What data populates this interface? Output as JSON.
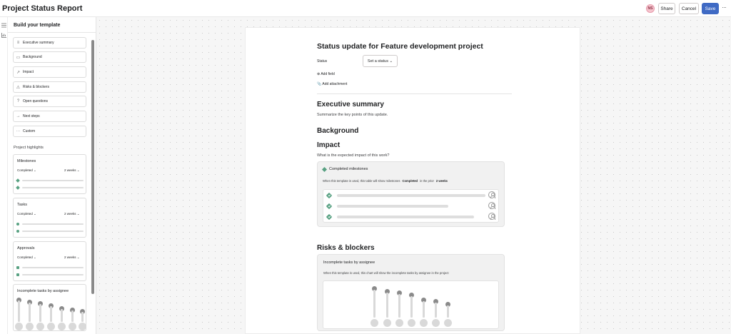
{
  "header": {
    "title": "Project Status Report",
    "avatar_initials": "NS",
    "share_label": "Share",
    "cancel_label": "Cancel",
    "save_label": "Save",
    "more_label": "···"
  },
  "sidebar": {
    "title": "Build your template",
    "items": [
      {
        "label": "Executive summary",
        "icon": "list-icon",
        "glyph": "≡"
      },
      {
        "label": "Background",
        "icon": "document-icon",
        "glyph": "▭"
      },
      {
        "label": "Impact",
        "icon": "trend-icon",
        "glyph": "↗"
      },
      {
        "label": "Risks & blockers",
        "icon": "warning-icon",
        "glyph": "⚠"
      },
      {
        "label": "Open questions",
        "icon": "question-icon",
        "glyph": "?"
      },
      {
        "label": "Next steps",
        "icon": "arrow-right-icon",
        "glyph": "→"
      },
      {
        "label": "Custom",
        "icon": "dots-icon",
        "glyph": "···"
      }
    ],
    "highlights_label": "Project highlights",
    "cards": [
      {
        "title": "Milestones",
        "filter": "Completed",
        "period": "2 weeks",
        "marker": "diamond"
      },
      {
        "title": "Tasks",
        "filter": "Completed",
        "period": "2 weeks",
        "marker": "dot"
      },
      {
        "title": "Approvals",
        "filter": "Completed",
        "period": "2 weeks",
        "marker": "square"
      },
      {
        "title": "Incomplete tasks by assignee"
      }
    ]
  },
  "document": {
    "title": "Status update for Feature development project",
    "status_label": "Status",
    "status_placeholder": "Set a status",
    "add_field": "Add field",
    "add_attachment": "Add attachment",
    "sections": {
      "exec_title": "Executive summary",
      "exec_prompt": "Summarize the key points of this update.",
      "background_title": "Background",
      "impact_title": "Impact",
      "impact_prompt": "What is the expected impact of this work?",
      "risks_title": "Risks & blockers"
    },
    "milestones_widget": {
      "title": "Completed milestones",
      "desc_prefix": "When this template is used, this table will show milestones",
      "desc_status": "Completed",
      "desc_mid": "in the prior",
      "desc_period": "2 weeks"
    },
    "tasks_widget": {
      "title": "Incomplete tasks by assignee",
      "desc": "When this template is used, this chart will show the incomplete tasks by assignee in the project"
    }
  },
  "colors": {
    "accent": "#3f6ac4",
    "marker_green": "#58a182",
    "avatar_bg": "#f5c6cf"
  }
}
